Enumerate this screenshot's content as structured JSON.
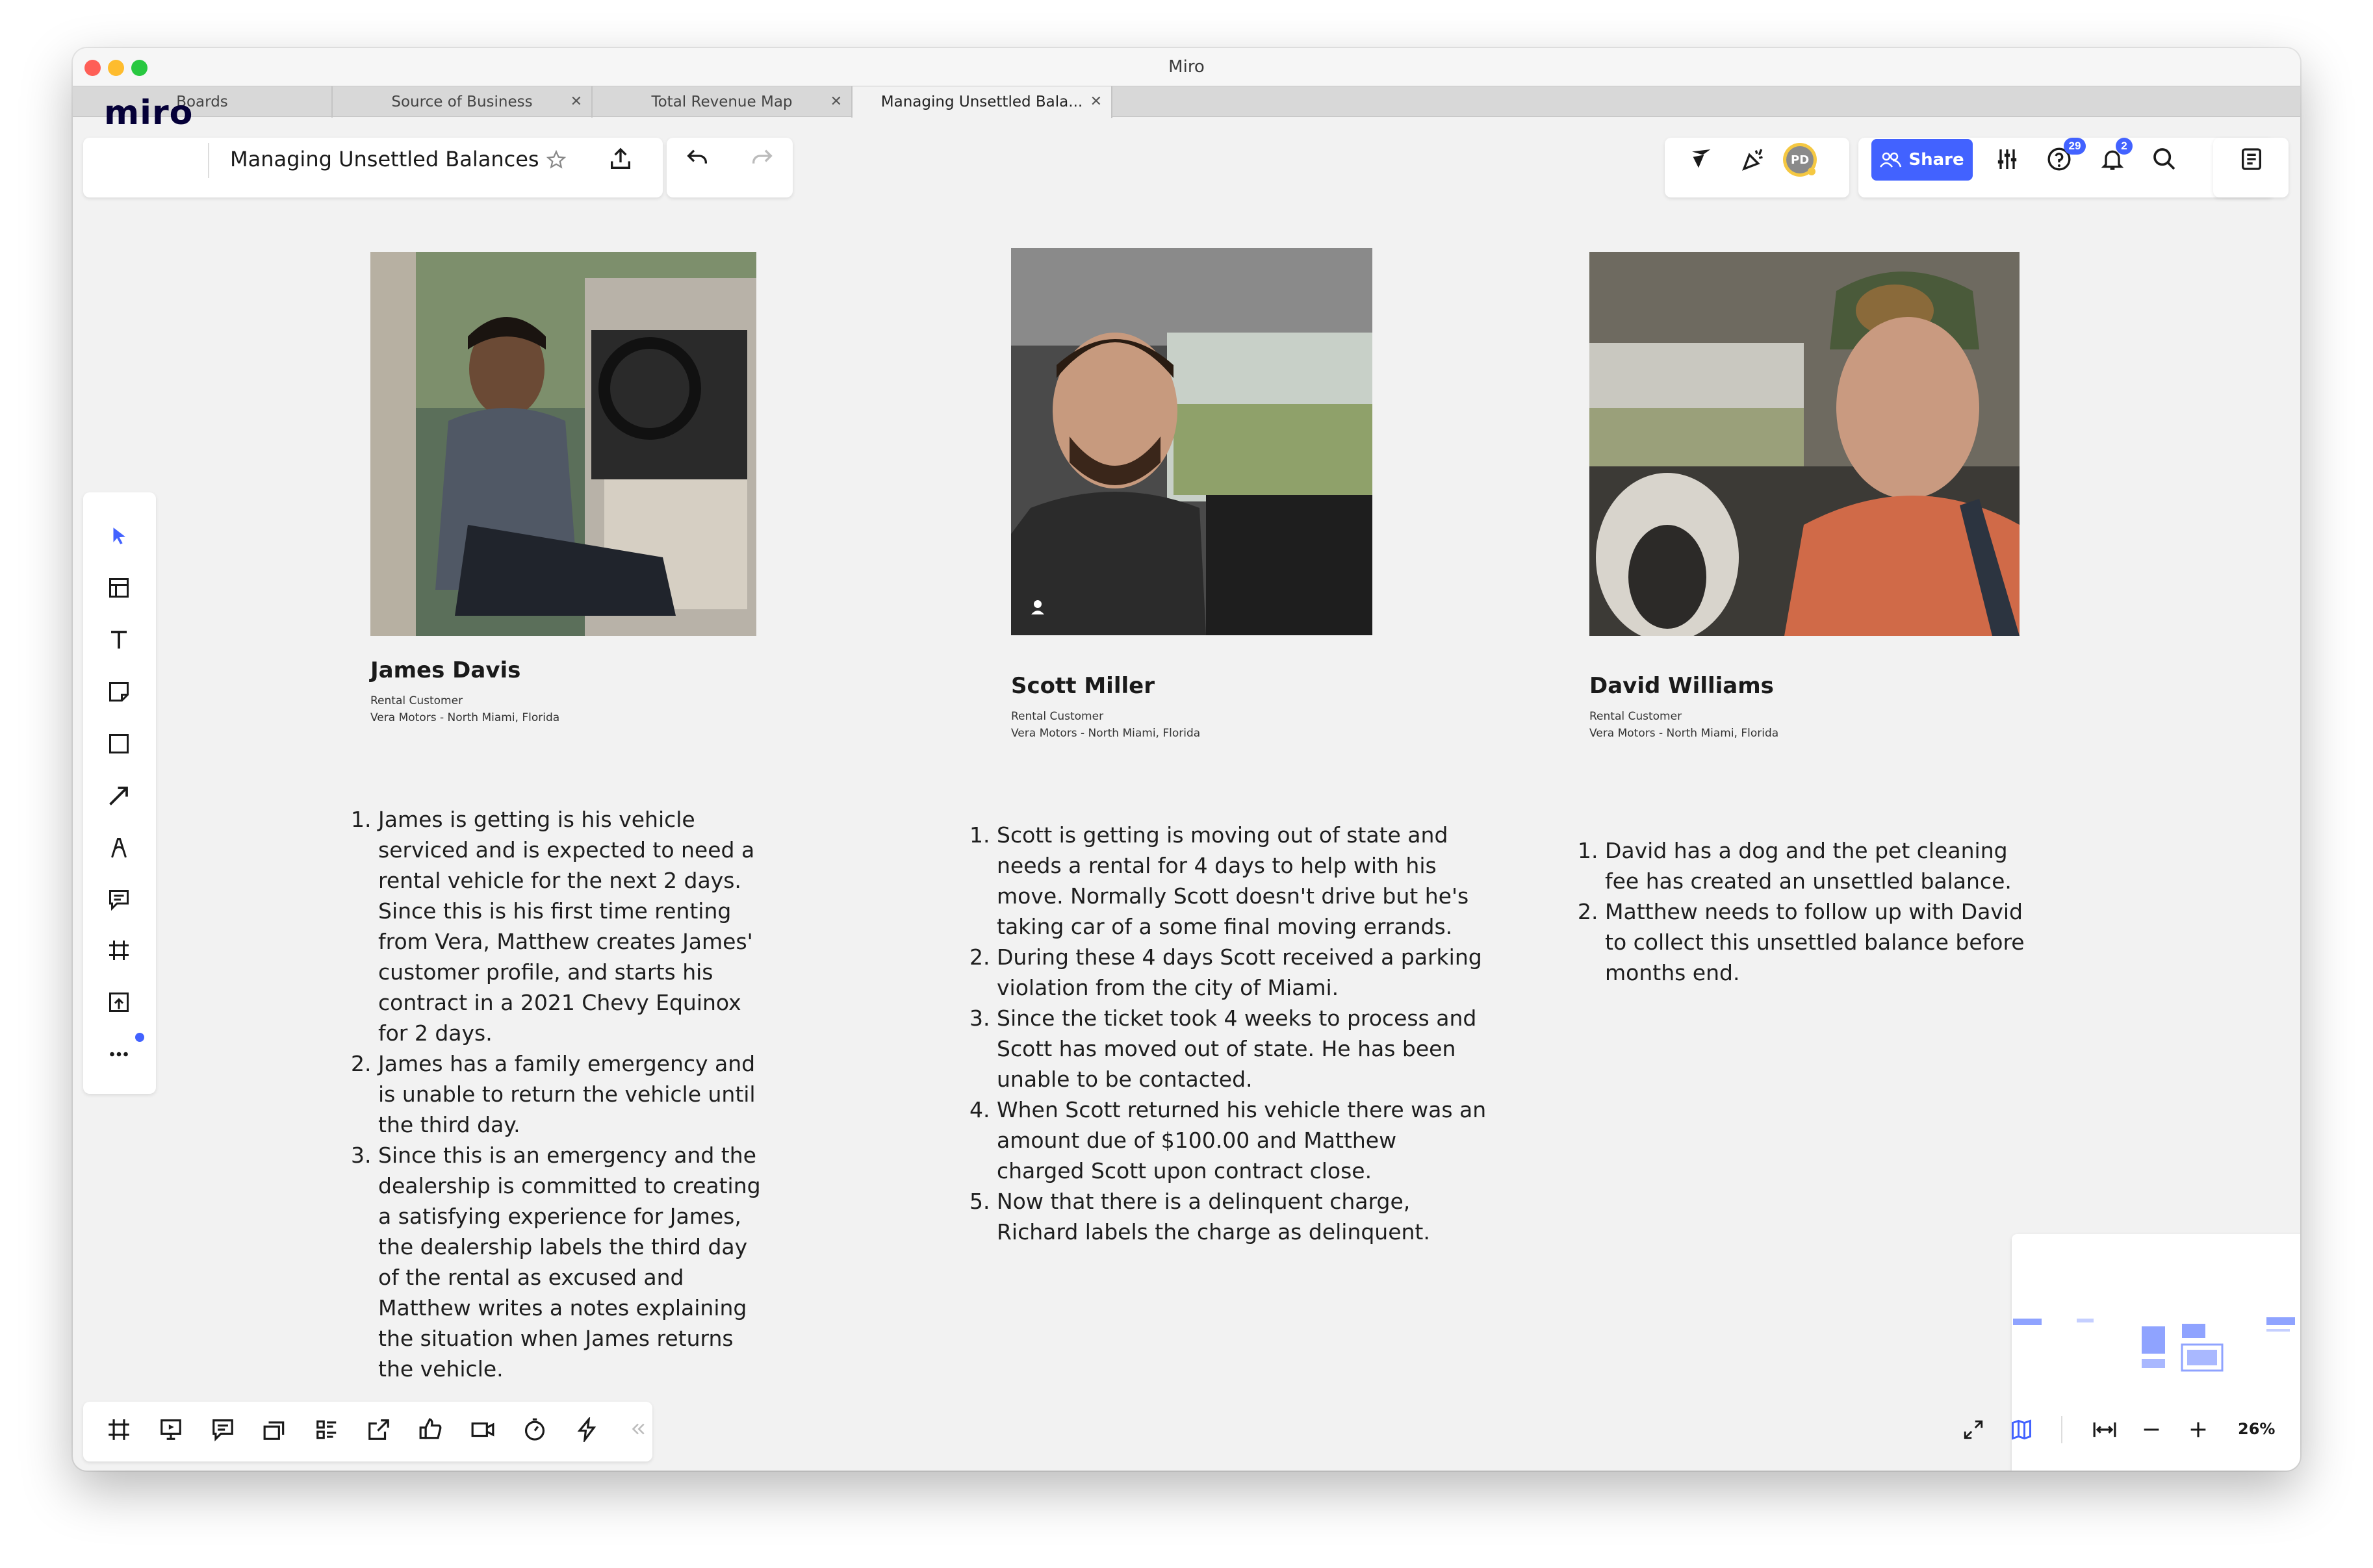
{
  "window": {
    "title": "Miro"
  },
  "tabs": [
    {
      "label": "Boards",
      "closable": false
    },
    {
      "label": "Source of Business",
      "closable": true
    },
    {
      "label": "Total Revenue Map",
      "closable": true
    },
    {
      "label": "Managing Unsettled Bala...",
      "closable": true,
      "active": true
    }
  ],
  "header": {
    "logo": "miro",
    "board_title": "Managing Unsettled Balances",
    "share_label": "Share",
    "avatar_initials": "PD",
    "help_badge": "29",
    "notifications_badge": "2"
  },
  "toolbar_left": {
    "tools": [
      "select-icon",
      "templates-icon",
      "text-icon",
      "sticky-note-icon",
      "shape-icon",
      "arrow-icon",
      "pen-icon",
      "comment-icon",
      "frame-icon",
      "upload-icon",
      "more-icon"
    ]
  },
  "toolbar_bottom": {
    "tools": [
      "frames-icon",
      "presentation-icon",
      "comments-icon",
      "cards-icon",
      "list-icon",
      "share-screen-icon",
      "reactions-icon",
      "video-icon",
      "timer-icon",
      "lightning-icon",
      "collapse-icon"
    ]
  },
  "customers": [
    {
      "name": "James Davis",
      "role": "Rental Customer",
      "location": "Vera Motors - North Miami, Florida",
      "notes": [
        "James is getting is his vehicle serviced and is expected to need a rental vehicle for the next 2 days. Since this is his first time renting from Vera, Matthew creates James' customer profile, and starts his contract in a 2021 Chevy Equinox for 2 days.",
        "James has a family emergency and is unable to return the vehicle until the third day.",
        "Since this is an emergency and the dealership is committed to creating a satisfying experience for James, the dealership labels the third day of the rental as excused and Matthew writes a notes explaining the situation when James returns the vehicle."
      ]
    },
    {
      "name": "Scott Miller",
      "role": "Rental Customer",
      "location": "Vera Motors - North Miami, Florida",
      "notes": [
        "Scott is getting is moving out of state and needs a rental for 4 days to help with his move. Normally Scott doesn't drive but he's taking car of a some final moving errands.",
        "During these 4 days Scott received a parking  violation from the city of Miami.",
        "Since the ticket took 4 weeks to process and Scott has moved out of state. He has been unable to be contacted.",
        "When Scott returned his vehicle there was an amount due of $100.00 and Matthew charged Scott upon contract close.",
        "Now that there is a delinquent charge, Richard labels the charge as delinquent."
      ]
    },
    {
      "name": "David Williams",
      "role": "Rental Customer",
      "location": "Vera Motors - North Miami, Florida",
      "notes": [
        "David has a dog and the pet cleaning fee has created an unsettled balance.",
        "Matthew needs to follow up with David to collect this unsettled balance before months end."
      ]
    }
  ],
  "zoom": {
    "level": "26%"
  },
  "colors": {
    "accent": "#4262ff",
    "canvas": "#f2f2f2",
    "ink": "#050038"
  }
}
